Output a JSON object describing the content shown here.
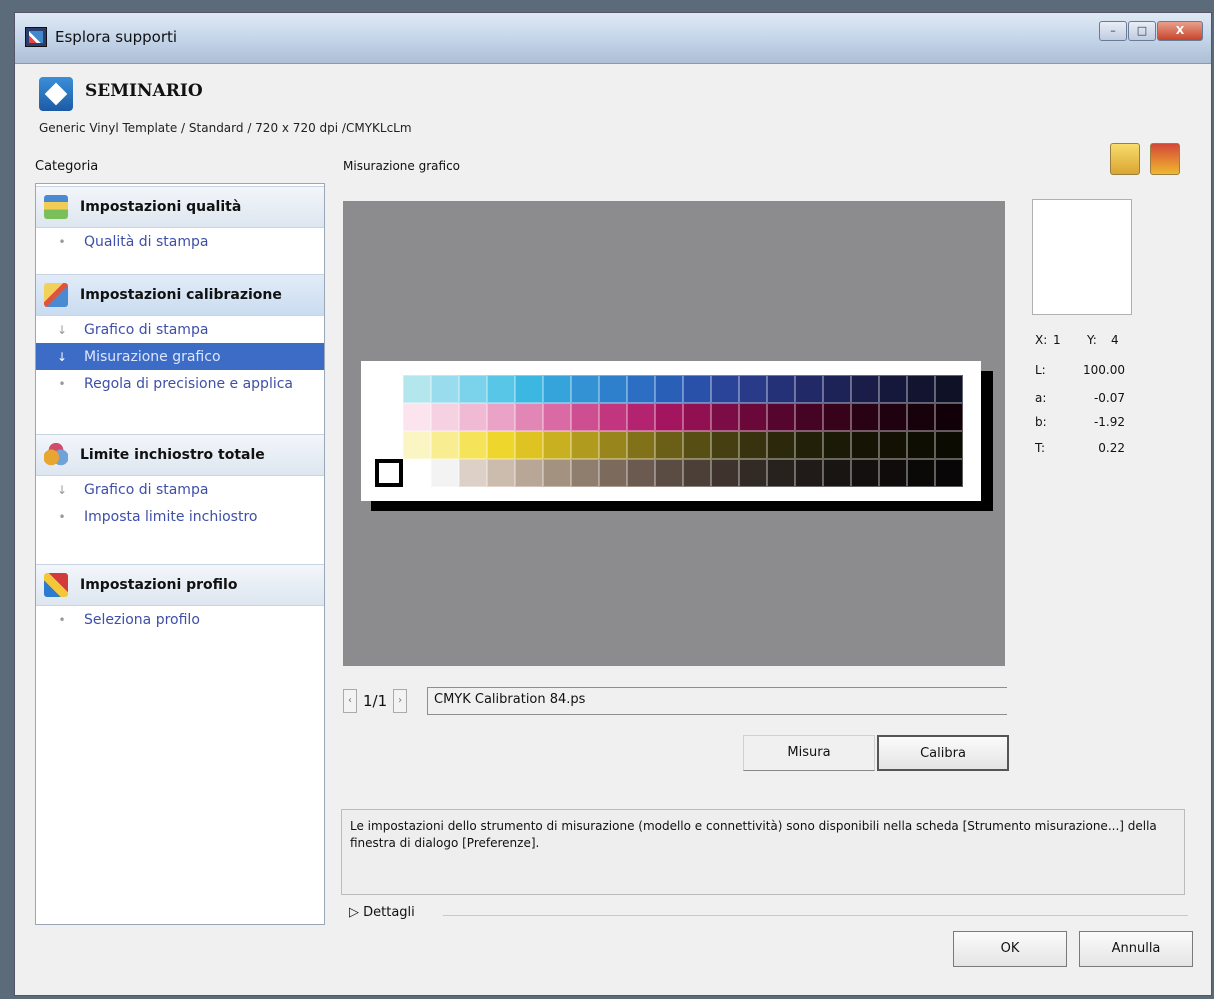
{
  "window": {
    "title": "Esplora supporti",
    "buttons": [
      "minimize",
      "maximize",
      "close"
    ],
    "close_glyph": "X"
  },
  "header": {
    "name": "SEMINARIO",
    "subtitle": "Generic Vinyl Template / Standard / 720 x 720 dpi /CMYKLcLm"
  },
  "sidebar": {
    "label": "Categoria",
    "groups": [
      {
        "title": "Impostazioni qualità",
        "icon": "quality-settings-icon",
        "items": [
          {
            "label": "Qualità di stampa",
            "bullet": "•",
            "selected": false
          }
        ]
      },
      {
        "title": "Impostazioni calibrazione",
        "icon": "calibration-settings-icon",
        "items": [
          {
            "label": "Grafico di stampa",
            "bullet": "↓",
            "selected": false
          },
          {
            "label": "Misurazione grafico",
            "bullet": "↓",
            "selected": true
          },
          {
            "label": "Regola di precisione e applica",
            "bullet": "•",
            "selected": false
          }
        ]
      },
      {
        "title": "Limite inchiostro totale",
        "icon": "ink-limit-icon",
        "items": [
          {
            "label": "Grafico di stampa",
            "bullet": "↓",
            "selected": false
          },
          {
            "label": "Imposta limite inchiostro",
            "bullet": "•",
            "selected": false
          }
        ]
      },
      {
        "title": "Impostazioni profilo",
        "icon": "profile-settings-icon",
        "items": [
          {
            "label": "Seleziona profilo",
            "bullet": "•",
            "selected": false
          }
        ]
      }
    ]
  },
  "main": {
    "section_label": "Misurazione grafico",
    "toolbar": {
      "open_icon": "open-folder-icon",
      "save_icon": "save-icon"
    },
    "chart": {
      "rows": [
        [
          "#ffffff",
          "#b4e6ee",
          "#98dced",
          "#7ad3ea",
          "#58c6e6",
          "#3cb7e1",
          "#35a4da",
          "#3292d3",
          "#2e80cc",
          "#2b6ec3",
          "#2a5fb8",
          "#2a51aa",
          "#2a449a",
          "#283a88",
          "#253176",
          "#212a66",
          "#1d2356",
          "#191d48",
          "#16183b",
          "#121430",
          "#0f1126"
        ],
        [
          "#ffffff",
          "#fbe4ee",
          "#f6d1e2",
          "#f0bad4",
          "#eaa2c6",
          "#e286b5",
          "#d96aa3",
          "#ce4f91",
          "#c2367f",
          "#b3236f",
          "#a3165f",
          "#901052",
          "#7c0c45",
          "#690839",
          "#56062e",
          "#450423",
          "#36031b",
          "#290214",
          "#1f010f",
          "#17010b",
          "#110008"
        ],
        [
          "#ffffff",
          "#fbf5c3",
          "#f8ee91",
          "#f5e35a",
          "#eed62c",
          "#dfc322",
          "#c9b020",
          "#b19b1e",
          "#98851c",
          "#81721a",
          "#6b5f17",
          "#574e14",
          "#463f11",
          "#38320e",
          "#2c280b",
          "#222009",
          "#1b1a07",
          "#161505",
          "#121104",
          "#0e0e03",
          "#0b0b02"
        ],
        [
          "#ffffff",
          "#ffffff",
          "#f3f3f3",
          "#ddd0c6",
          "#cbbcae",
          "#b8a797",
          "#a49281",
          "#8f7d6e",
          "#7c6b5d",
          "#6a5a4f",
          "#5a4c42",
          "#4b3f37",
          "#3e342d",
          "#322a25",
          "#28221e",
          "#201b18",
          "#191513",
          "#13100f",
          "#0f0c0b",
          "#0b0908",
          "#080606"
        ]
      ],
      "selected_cell": {
        "x": 1,
        "y": 4
      }
    },
    "measurement": {
      "x_label": "X:",
      "x": "1",
      "y_label": "Y:",
      "y": "4",
      "L_label": "L:",
      "L": "100.00",
      "a_label": "a:",
      "a": "-0.07",
      "b_label": "b:",
      "b": "-1.92",
      "T_label": "T:",
      "T": "0.22",
      "swatch_color": "#ffffff"
    },
    "pager": {
      "prev": "‹",
      "page": "1/1",
      "next": "›",
      "file": "CMYK Calibration 84.ps"
    },
    "buttons": {
      "measure": "Misura",
      "calibrate": "Calibra"
    },
    "info": "Le impostazioni dello strumento di misurazione (modello e connettività) sono disponibili nella scheda [Strumento misurazione...] della finestra di dialogo [Preferenze].",
    "details": "▷ Dettagli"
  },
  "footer": {
    "ok": "OK",
    "cancel": "Annulla"
  },
  "colors": {
    "preview_bg": "#8c8c8e",
    "selection": "#3c6cc5",
    "link": "#3d4fa8"
  }
}
